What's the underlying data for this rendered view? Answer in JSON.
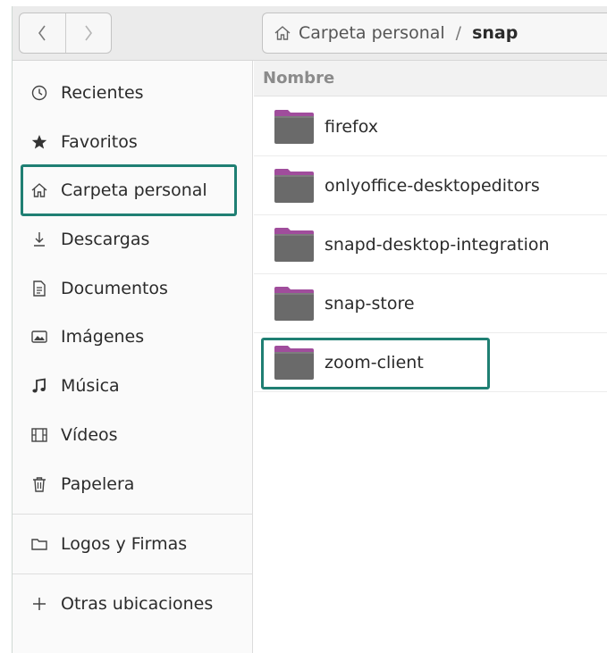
{
  "path": {
    "home_label": "Carpeta personal",
    "separator": "/",
    "current": "snap"
  },
  "sidebar": {
    "items": [
      {
        "label": "Recientes",
        "icon": "clock-icon"
      },
      {
        "label": "Favoritos",
        "icon": "star-icon"
      },
      {
        "label": "Carpeta personal",
        "icon": "home-icon"
      },
      {
        "label": "Descargas",
        "icon": "download-icon"
      },
      {
        "label": "Documentos",
        "icon": "document-icon"
      },
      {
        "label": "Imágenes",
        "icon": "image-icon"
      },
      {
        "label": "Música",
        "icon": "music-note-icon"
      },
      {
        "label": "Vídeos",
        "icon": "film-icon"
      },
      {
        "label": "Papelera",
        "icon": "trash-icon"
      }
    ],
    "bookmarks": [
      {
        "label": "Logos y Firmas",
        "icon": "folder-icon"
      }
    ],
    "other": {
      "label": "Otras ubicaciones",
      "icon": "plus-icon"
    }
  },
  "list": {
    "column_name": "Nombre",
    "files": [
      "firefox",
      "onlyoffice-desktopeditors",
      "snapd-desktop-integration",
      "snap-store",
      "zoom-client"
    ]
  },
  "colors": {
    "highlight": "#1f7f73",
    "folder_tab": "#a04d9c",
    "folder_body": "#6a6a6a"
  }
}
